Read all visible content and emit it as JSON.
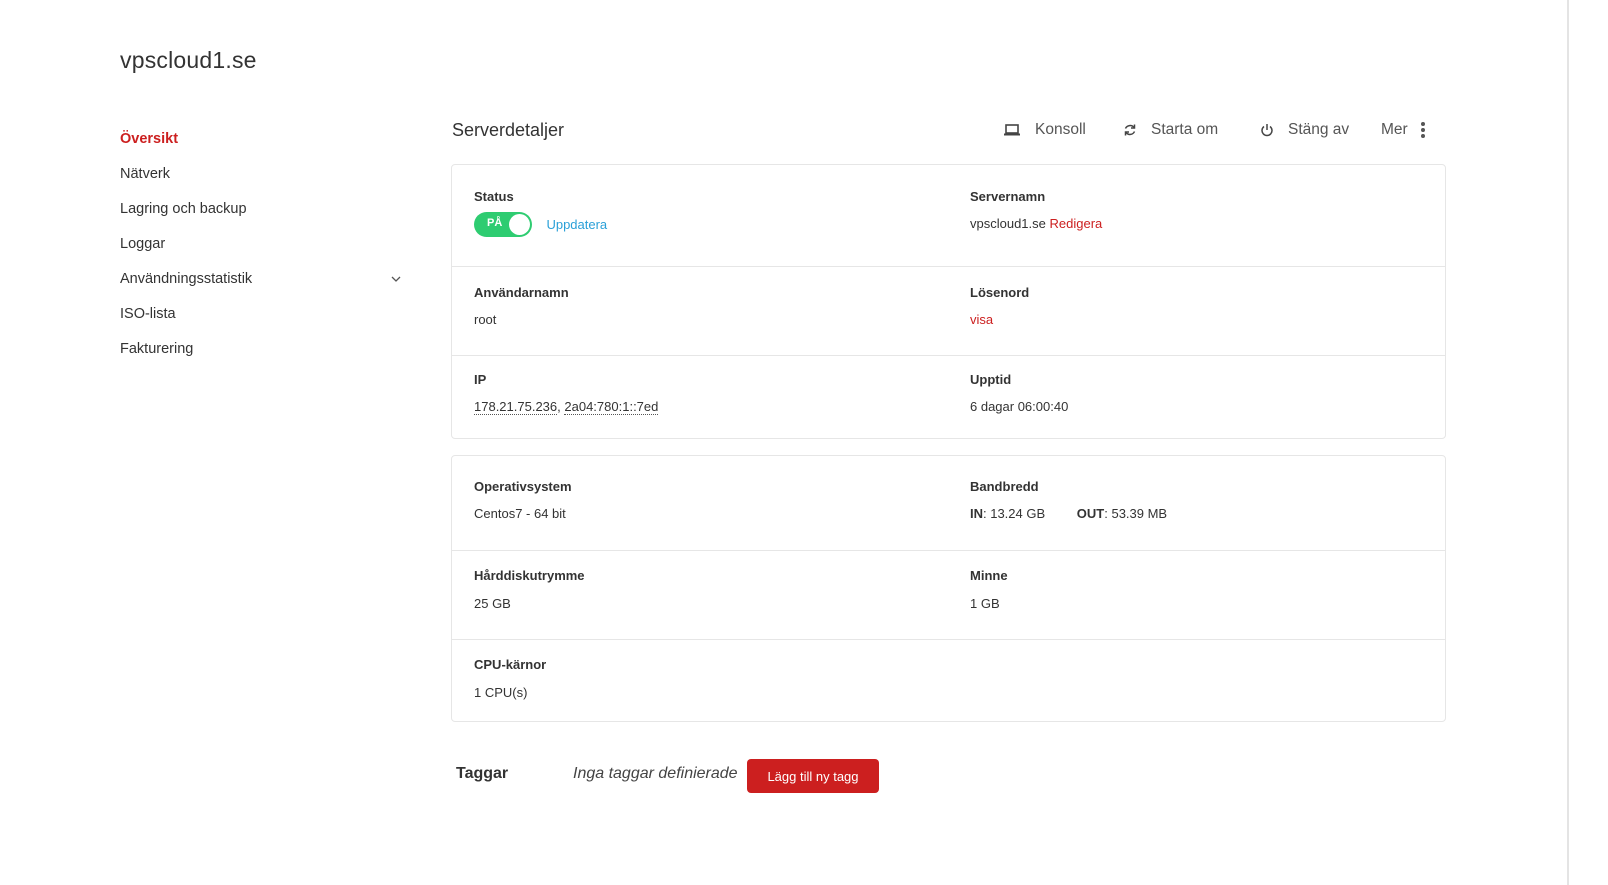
{
  "site": {
    "title": "vpscloud1.se"
  },
  "sidebar": {
    "items": [
      {
        "label": "Översikt",
        "active": true
      },
      {
        "label": "Nätverk"
      },
      {
        "label": "Lagring och backup"
      },
      {
        "label": "Loggar"
      },
      {
        "label": "Användningsstatistik",
        "has_dropdown": true,
        "icon": "chevron-down-icon"
      },
      {
        "label": "ISO-lista"
      },
      {
        "label": "Fakturering"
      }
    ]
  },
  "header": {
    "title": "Serverdetaljer",
    "actions": [
      {
        "label": "Konsoll",
        "icon": "laptop-icon"
      },
      {
        "label": "Starta om",
        "icon": "refresh-icon"
      },
      {
        "label": "Stäng av",
        "icon": "power-icon"
      },
      {
        "label": "Mer",
        "icon": "more-vertical-icon"
      }
    ]
  },
  "details": {
    "status": {
      "label": "Status",
      "toggle_text": "PÅ",
      "toggle_on": true,
      "update_label": "Uppdatera"
    },
    "servername": {
      "label": "Servernamn",
      "value": "vpscloud1.se",
      "edit_label": "Redigera"
    },
    "username": {
      "label": "Användarnamn",
      "value": "root"
    },
    "password": {
      "label": "Lösenord",
      "show_label": "visa"
    },
    "ip": {
      "label": "IP",
      "ipv4": "178.21.75.236",
      "separator": ",",
      "ipv6": "2a04:780:1::7ed"
    },
    "uptime": {
      "label": "Upptid",
      "value": "6 dagar 06:00:40"
    }
  },
  "specs": {
    "os": {
      "label": "Operativsystem",
      "value": "Centos7 - 64 bit"
    },
    "bandwidth": {
      "label": "Bandbredd",
      "in_label": "IN",
      "in_value": ": 13.24 GB",
      "out_label": "OUT",
      "out_value": ": 53.39 MB"
    },
    "disk": {
      "label": "Hårddiskutrymme",
      "value": "25 GB"
    },
    "memory": {
      "label": "Minne",
      "value": "1 GB"
    },
    "cpu": {
      "label": "CPU-kärnor",
      "value": "1 CPU(s)"
    }
  },
  "tags": {
    "label": "Taggar",
    "empty_text": "Inga taggar definierade",
    "add_button": "Lägg till ny tagg"
  },
  "colors": {
    "accent": "#cc1f1f",
    "toggle_on": "#2ecc71",
    "link_blue": "#2aa0d8",
    "border": "#e6e6e6"
  }
}
